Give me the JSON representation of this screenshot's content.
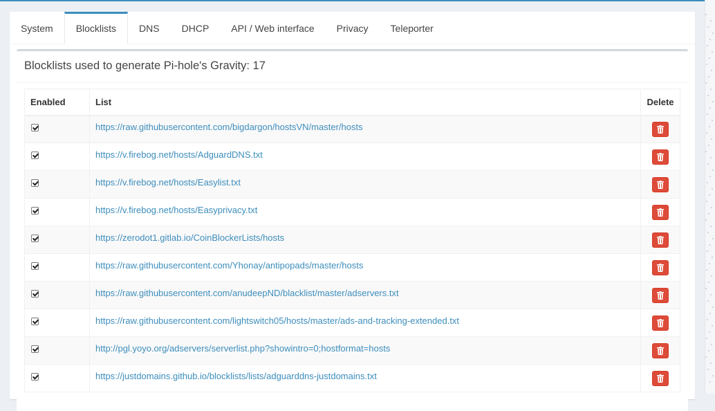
{
  "tabs": [
    {
      "label": "System",
      "active": false
    },
    {
      "label": "Blocklists",
      "active": true
    },
    {
      "label": "DNS",
      "active": false
    },
    {
      "label": "DHCP",
      "active": false
    },
    {
      "label": "API / Web interface",
      "active": false
    },
    {
      "label": "Privacy",
      "active": false
    },
    {
      "label": "Teleporter",
      "active": false
    }
  ],
  "box": {
    "title": "Blocklists used to generate Pi-hole's Gravity: 17"
  },
  "table": {
    "headers": {
      "enabled": "Enabled",
      "list": "List",
      "delete": "Delete"
    },
    "rows": [
      {
        "enabled": true,
        "url": "https://raw.githubusercontent.com/bigdargon/hostsVN/master/hosts"
      },
      {
        "enabled": true,
        "url": "https://v.firebog.net/hosts/AdguardDNS.txt"
      },
      {
        "enabled": true,
        "url": "https://v.firebog.net/hosts/Easylist.txt"
      },
      {
        "enabled": true,
        "url": "https://v.firebog.net/hosts/Easyprivacy.txt"
      },
      {
        "enabled": true,
        "url": "https://zerodot1.gitlab.io/CoinBlockerLists/hosts"
      },
      {
        "enabled": true,
        "url": "https://raw.githubusercontent.com/Yhonay/antipopads/master/hosts"
      },
      {
        "enabled": true,
        "url": "https://raw.githubusercontent.com/anudeepND/blacklist/master/adservers.txt"
      },
      {
        "enabled": true,
        "url": "https://raw.githubusercontent.com/lightswitch05/hosts/master/ads-and-tracking-extended.txt"
      },
      {
        "enabled": true,
        "url": "http://pgl.yoyo.org/adservers/serverlist.php?showintro=0;hostformat=hosts"
      },
      {
        "enabled": true,
        "url": "https://justdomains.github.io/blocklists/lists/adguarddns-justdomains.txt"
      }
    ]
  },
  "icons": {
    "delete": "trash-icon",
    "checkbox": "checkmark-icon"
  },
  "colors": {
    "accent": "#3c8dbc",
    "danger": "#dd4b39",
    "link": "#3c8dbc"
  }
}
